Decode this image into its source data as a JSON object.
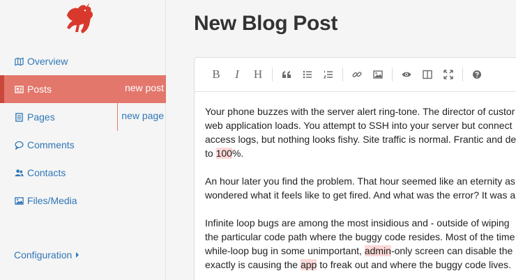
{
  "sidebar": {
    "logo": "red-horse-logo",
    "items": [
      {
        "label": "Overview",
        "icon": "map-icon"
      },
      {
        "label": "Posts",
        "icon": "newspaper-icon",
        "sub": "new post",
        "active": true
      },
      {
        "label": "Pages",
        "icon": "file-text-icon",
        "sub": "new page"
      },
      {
        "label": "Comments",
        "icon": "comment-icon"
      },
      {
        "label": "Contacts",
        "icon": "users-icon"
      },
      {
        "label": "Files/Media",
        "icon": "image-icon"
      }
    ],
    "configuration": "Configuration"
  },
  "main": {
    "title": "New Blog Post"
  },
  "toolbar": {
    "buttons": [
      "B",
      "I",
      "H",
      "quote-icon",
      "bullet-list-icon",
      "numbered-list-icon",
      "link-icon",
      "image-icon",
      "preview-eye-icon",
      "side-by-side-icon",
      "fullscreen-icon",
      "help-icon"
    ]
  },
  "content": {
    "p1": {
      "l1": "Your phone buzzes with the server alert ring-tone. The director of custor",
      "l2": "web application loads. You attempt to SSH into your server but connect",
      "l3": "access logs, but nothing looks fishy. Site traffic is normal. Frantic and de",
      "l4_pre": "to ",
      "l4_hl": "100",
      "l4_post": "%."
    },
    "p2": {
      "l1": "An hour later you find the problem. That hour seemed like an eternity as",
      "l2": "wondered what it feels like to get fired. And what was the error? It was a"
    },
    "p3": {
      "l1": "Infinite loop bugs are among the most insidious and - outside of wiping",
      "l2": "the particular code path where the buggy code resides. Most of the time",
      "l3_pre": "while-loop bug in some unimportant, ",
      "l3_hl": "admin",
      "l3_post": "-only screen can disable the",
      "l4_pre": "exactly is causing the ",
      "l4_hl": "app",
      "l4_post": " to freak out and where the buggy code lives."
    }
  },
  "colors": {
    "accent": "#e3776c",
    "accent_dark": "#c9483c",
    "link": "#2f77b7",
    "highlight": "#fdd8d8"
  }
}
